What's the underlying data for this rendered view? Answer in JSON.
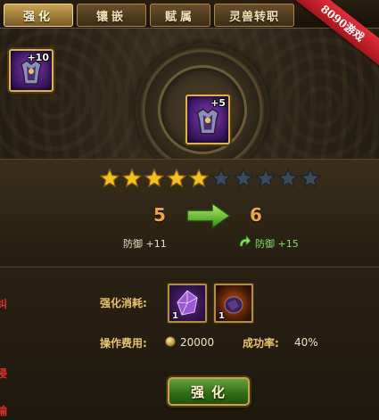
{
  "tabs": [
    {
      "label": "强化",
      "active": true
    },
    {
      "label": "镶嵌",
      "active": false
    },
    {
      "label": "赋属",
      "active": false
    },
    {
      "label": "灵兽转职",
      "active": false
    }
  ],
  "ribbon": "8090游戏",
  "equipped_item": {
    "plus": "+10",
    "icon": "armor-icon"
  },
  "center_item": {
    "plus": "+5",
    "icon": "armor-icon"
  },
  "stars": {
    "filled": 5,
    "total": 10
  },
  "level_from": "5",
  "level_to": "6",
  "stat_old": "防御 +11",
  "stat_new": "防御 +15",
  "cost": {
    "label": "强化消耗:",
    "materials": [
      {
        "icon": "purple-gem-icon",
        "count": "1"
      },
      {
        "icon": "fire-stone-icon",
        "count": "1"
      }
    ]
  },
  "fee": {
    "label": "操作费用:",
    "value": "20000"
  },
  "success": {
    "label": "成功率:",
    "value": "40%"
  },
  "enhance_button": "强化",
  "edge_chars": [
    "纠",
    "浸",
    "输"
  ],
  "colors": {
    "accent_gold": "#e9c469",
    "level_orange": "#f0a34a",
    "stat_green": "#7fe06a",
    "ribbon_red": "#d8232c"
  }
}
